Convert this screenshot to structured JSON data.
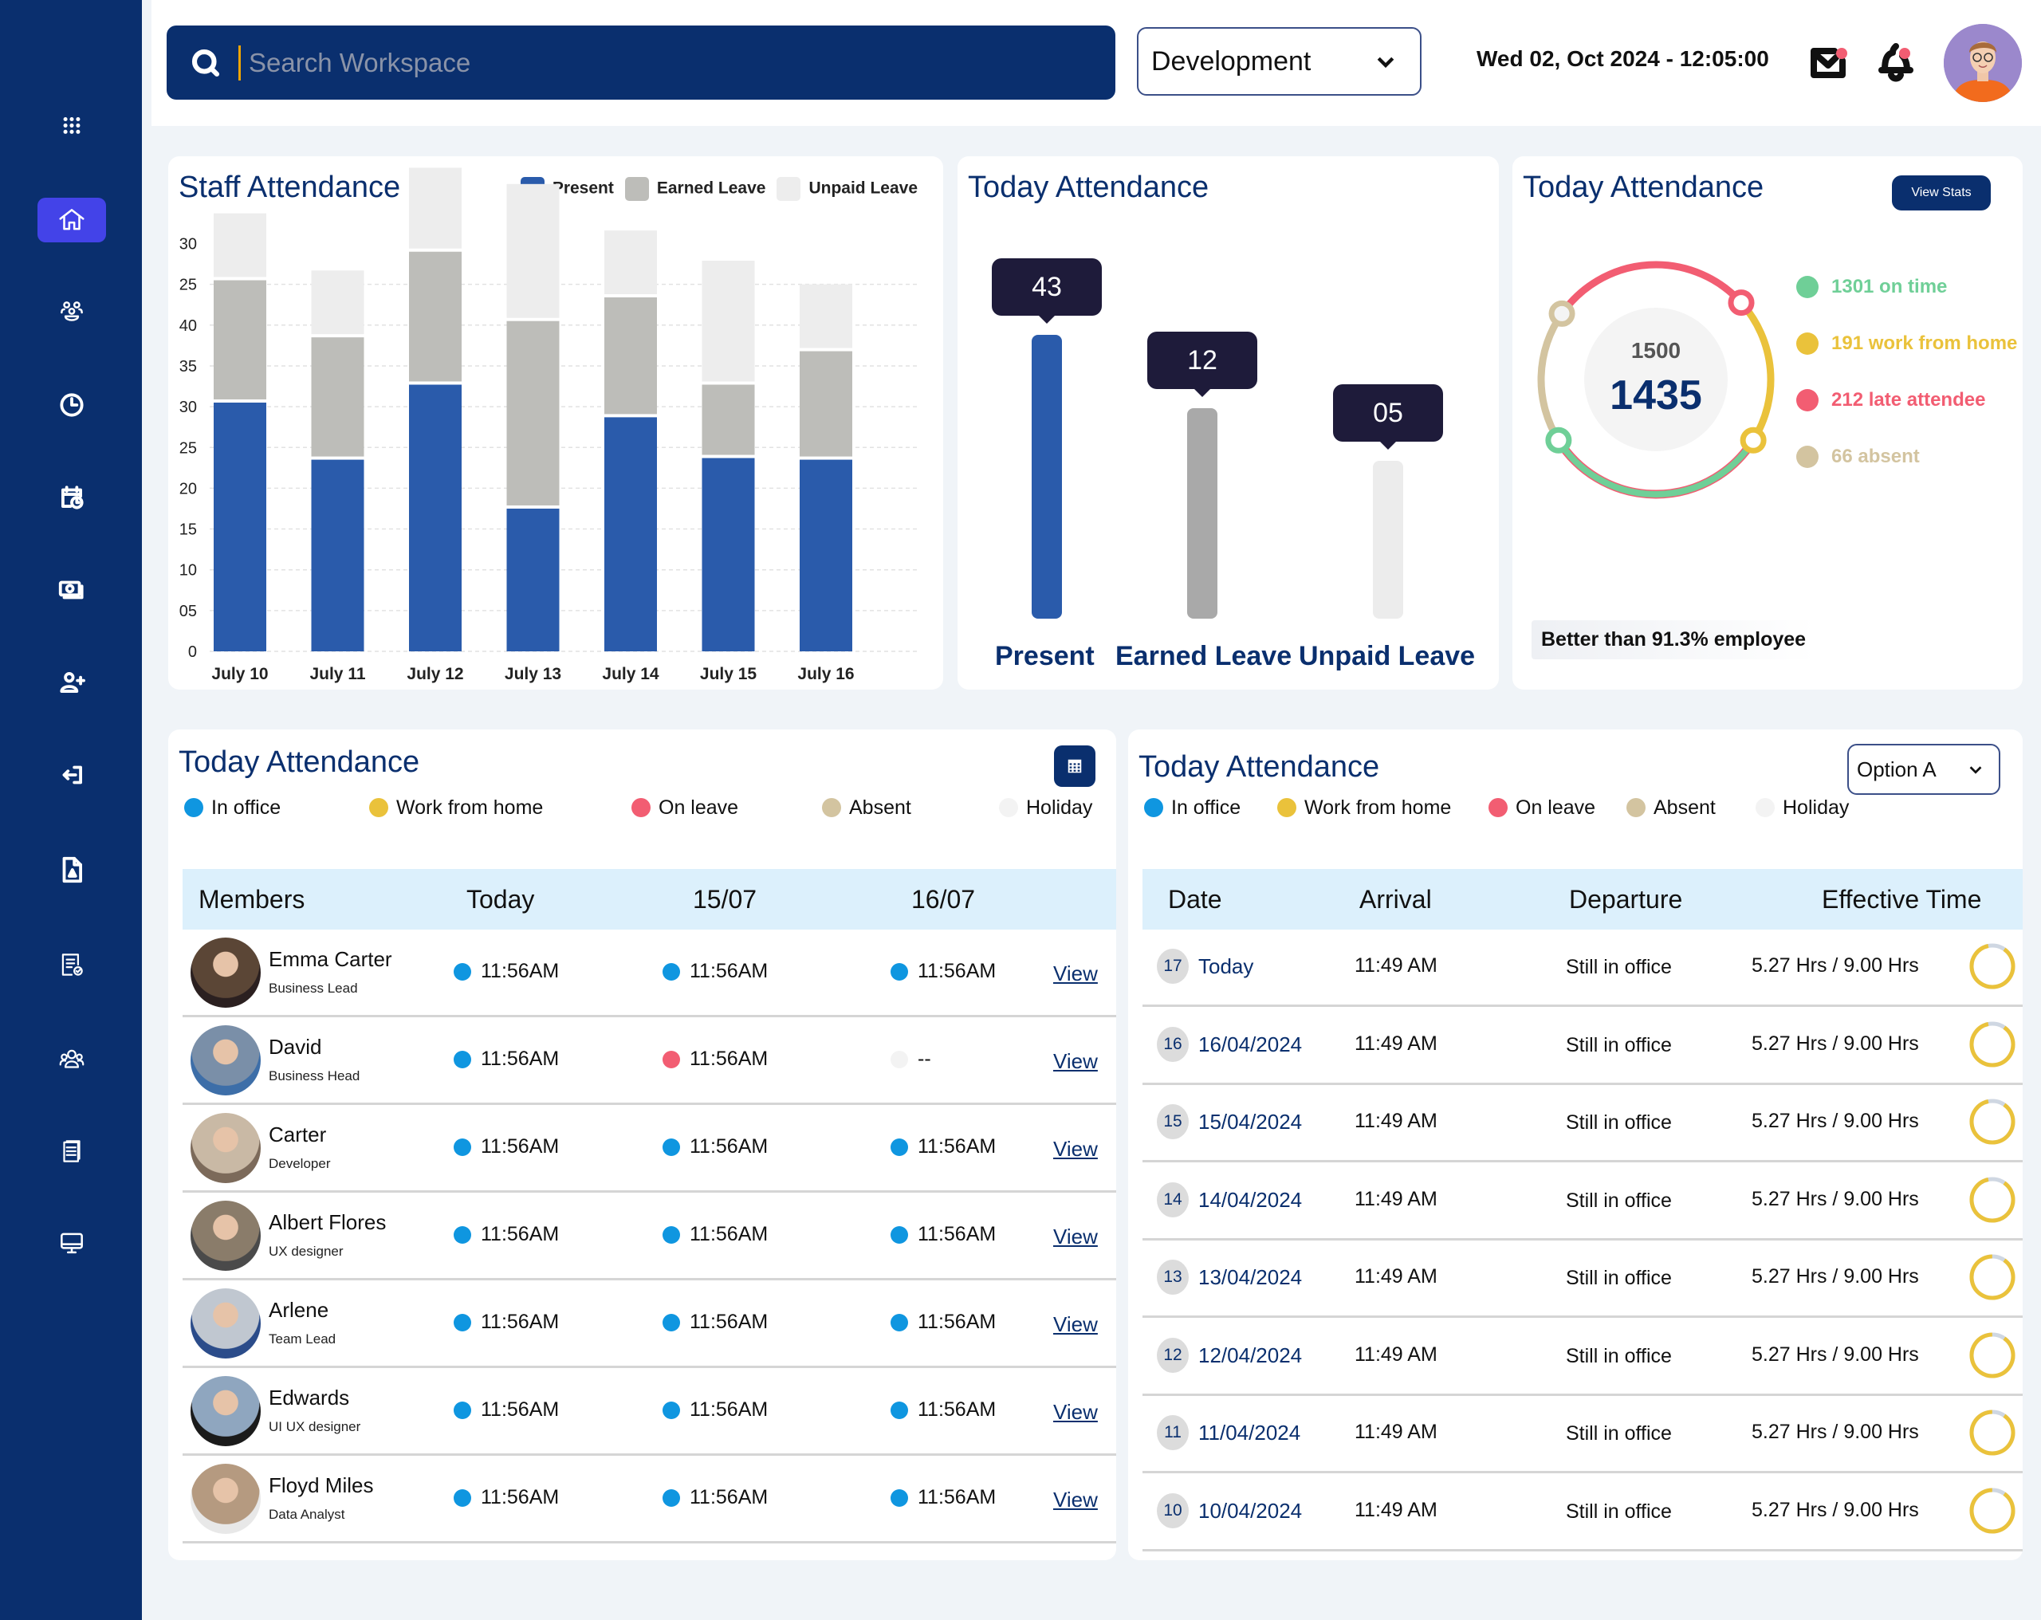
{
  "sidebar": {
    "items": [
      {
        "name": "apps",
        "icon": "grid-dots-icon",
        "active": false
      },
      {
        "name": "home",
        "icon": "home-icon",
        "active": true
      },
      {
        "name": "team",
        "icon": "team-icon",
        "active": false
      },
      {
        "name": "time",
        "icon": "clock-icon",
        "active": false
      },
      {
        "name": "schedule",
        "icon": "calendar-clock-icon",
        "active": false
      },
      {
        "name": "payroll",
        "icon": "money-icon",
        "active": false
      },
      {
        "name": "add-user",
        "icon": "user-plus-icon",
        "active": false
      },
      {
        "name": "logout",
        "icon": "logout-icon",
        "active": false
      },
      {
        "name": "documents",
        "icon": "pdf-file-icon",
        "active": false
      },
      {
        "name": "checklist",
        "icon": "checklist-icon",
        "active": false
      },
      {
        "name": "groups",
        "icon": "people-group-icon",
        "active": false
      },
      {
        "name": "reports",
        "icon": "files-icon",
        "active": false
      },
      {
        "name": "devices",
        "icon": "monitor-icon",
        "active": false
      }
    ]
  },
  "header": {
    "search_placeholder": "Search Workspace",
    "department": "Development",
    "datetime": "Wed 02, Oct 2024 - 12:05:00",
    "mail_unread": true,
    "notifications_unread": true
  },
  "staff_card": {
    "title": "Staff Attendance",
    "legend": [
      "Present",
      "Earned Leave",
      "Unpaid Leave"
    ]
  },
  "chart_data": [
    {
      "type": "bar",
      "stacked": true,
      "title": "Staff Attendance",
      "categories": [
        "July 10",
        "July 11",
        "July 12",
        "July 13",
        "July 14",
        "July 15",
        "July 16"
      ],
      "series": [
        {
          "name": "Present",
          "color": "#2a5bab",
          "values": [
            30.5,
            23.5,
            32.7,
            17.5,
            28.7,
            23.7,
            23.5
          ]
        },
        {
          "name": "Earned Leave",
          "color": "#bdbdb9",
          "values": [
            15,
            15,
            16.3,
            23,
            14.7,
            9,
            13.3
          ]
        },
        {
          "name": "Unpaid Leave",
          "color": "#ededed",
          "values": [
            8.2,
            8.2,
            10.3,
            16.8,
            8.2,
            15.2,
            8.2
          ]
        }
      ],
      "ytick_labels": [
        "0",
        "05",
        "10",
        "15",
        "20",
        "25",
        "30",
        "35",
        "40",
        "25",
        "30"
      ],
      "ylim": [
        0,
        50
      ],
      "grid": true,
      "legend_position": "top-right",
      "xlabel": "",
      "ylabel": ""
    },
    {
      "type": "bar",
      "title": "Today Attendance",
      "categories": [
        "Present",
        "Earned Leave",
        "Unpaid Leave"
      ],
      "values": [
        43,
        12,
        5
      ],
      "value_labels": [
        "43",
        "12",
        "05"
      ],
      "colors": [
        "#2a5bab",
        "#a9a9a9",
        "#ececec"
      ]
    },
    {
      "type": "pie",
      "title": "Today Attendance",
      "total": "1500",
      "present": "1435",
      "slices": [
        {
          "label": "1301 on time",
          "value": 1301,
          "color": "#6fcf97"
        },
        {
          "label": "191 work from home",
          "value": 191,
          "color": "#eac23b"
        },
        {
          "label": "212 late attendee",
          "value": 212,
          "color": "#f25d72"
        },
        {
          "label": "66 absent",
          "value": 66,
          "color": "#d3c4a0"
        }
      ]
    }
  ],
  "today_bars_card": {
    "title": "Today Attendance",
    "labels": [
      "Present",
      "Earned Leave",
      "Unpaid Leave"
    ],
    "tips": [
      "43",
      "12",
      "05"
    ]
  },
  "donut_card": {
    "title": "Today Attendance",
    "view_stats_label": "View Stats",
    "total": "1500",
    "count": "1435",
    "legend": [
      "1301 on time",
      "191 work from home",
      "212 late attendee",
      "66 absent"
    ],
    "footer": "Better than 91.3% employee"
  },
  "members_card": {
    "title": "Today Attendance",
    "legend": [
      "In office",
      "Work from home",
      "On leave",
      "Absent",
      "Holiday"
    ],
    "columns": [
      "Members",
      "Today",
      "15/07",
      "16/07"
    ],
    "view_label": "View",
    "rows": [
      {
        "name": "Emma Carter",
        "role": "Business Lead",
        "cells": [
          {
            "status": "in-office",
            "time": "11:56AM"
          },
          {
            "status": "in-office",
            "time": "11:56AM"
          },
          {
            "status": "in-office",
            "time": "11:56AM"
          }
        ]
      },
      {
        "name": "David",
        "role": "Business Head",
        "cells": [
          {
            "status": "in-office",
            "time": "11:56AM"
          },
          {
            "status": "on-leave",
            "time": "11:56AM"
          },
          {
            "status": "holiday",
            "time": "--"
          }
        ]
      },
      {
        "name": "Carter",
        "role": "Developer",
        "cells": [
          {
            "status": "in-office",
            "time": "11:56AM"
          },
          {
            "status": "in-office",
            "time": "11:56AM"
          },
          {
            "status": "in-office",
            "time": "11:56AM"
          }
        ]
      },
      {
        "name": "Albert Flores",
        "role": "UX designer",
        "cells": [
          {
            "status": "in-office",
            "time": "11:56AM"
          },
          {
            "status": "in-office",
            "time": "11:56AM"
          },
          {
            "status": "in-office",
            "time": "11:56AM"
          }
        ]
      },
      {
        "name": "Arlene",
        "role": "Team Lead",
        "cells": [
          {
            "status": "in-office",
            "time": "11:56AM"
          },
          {
            "status": "in-office",
            "time": "11:56AM"
          },
          {
            "status": "in-office",
            "time": "11:56AM"
          }
        ]
      },
      {
        "name": "Edwards",
        "role": "UI UX designer",
        "cells": [
          {
            "status": "in-office",
            "time": "11:56AM"
          },
          {
            "status": "in-office",
            "time": "11:56AM"
          },
          {
            "status": "in-office",
            "time": "11:56AM"
          }
        ]
      },
      {
        "name": "Floyd Miles",
        "role": "Data Analyst",
        "cells": [
          {
            "status": "in-office",
            "time": "11:56AM"
          },
          {
            "status": "in-office",
            "time": "11:56AM"
          },
          {
            "status": "in-office",
            "time": "11:56AM"
          }
        ]
      }
    ]
  },
  "log_card": {
    "title": "Today Attendance",
    "select_value": "Option A",
    "legend": [
      "In office",
      "Work from home",
      "On leave",
      "Absent",
      "Holiday"
    ],
    "columns": [
      "Date",
      "Arrival",
      "Departure",
      "Effective Time"
    ],
    "rows": [
      {
        "day": "17",
        "date": "Today",
        "arrival": "11:49 AM",
        "departure": "Still in office",
        "effective": "5.27 Hrs / 9.00 Hrs",
        "progress": 0.87
      },
      {
        "day": "16",
        "date": "16/04/2024",
        "arrival": "11:49 AM",
        "departure": "Still in office",
        "effective": "5.27 Hrs / 9.00 Hrs",
        "progress": 0.87
      },
      {
        "day": "15",
        "date": "15/04/2024",
        "arrival": "11:49 AM",
        "departure": "Still in office",
        "effective": "5.27 Hrs / 9.00 Hrs",
        "progress": 0.87
      },
      {
        "day": "14",
        "date": "14/04/2024",
        "arrival": "11:49 AM",
        "departure": "Still in office",
        "effective": "5.27 Hrs / 9.00 Hrs",
        "progress": 0.87
      },
      {
        "day": "13",
        "date": "13/04/2024",
        "arrival": "11:49 AM",
        "departure": "Still in office",
        "effective": "5.27 Hrs / 9.00 Hrs",
        "progress": 0.9
      },
      {
        "day": "12",
        "date": "12/04/2024",
        "arrival": "11:49 AM",
        "departure": "Still in office",
        "effective": "5.27 Hrs / 9.00 Hrs",
        "progress": 0.9
      },
      {
        "day": "11",
        "date": "11/04/2024",
        "arrival": "11:49 AM",
        "departure": "Still in office",
        "effective": "5.27 Hrs / 9.00 Hrs",
        "progress": 0.9
      },
      {
        "day": "10",
        "date": "10/04/2024",
        "arrival": "11:49 AM",
        "departure": "Still in office",
        "effective": "5.27 Hrs / 9.00 Hrs",
        "progress": 0.9
      }
    ]
  },
  "status_colors": {
    "in-office": "#0f96e0",
    "work-from-home": "#eac23b",
    "on-leave": "#f25d72",
    "absent": "#d3c4a0",
    "holiday": "#f3f3f3"
  },
  "colors": {
    "primary": "#0a2f6e",
    "active_nav": "#4343e8",
    "accent_caret": "#f0a500",
    "ring_fill": "#eac23b",
    "ring_track": "#cfd7e2"
  }
}
